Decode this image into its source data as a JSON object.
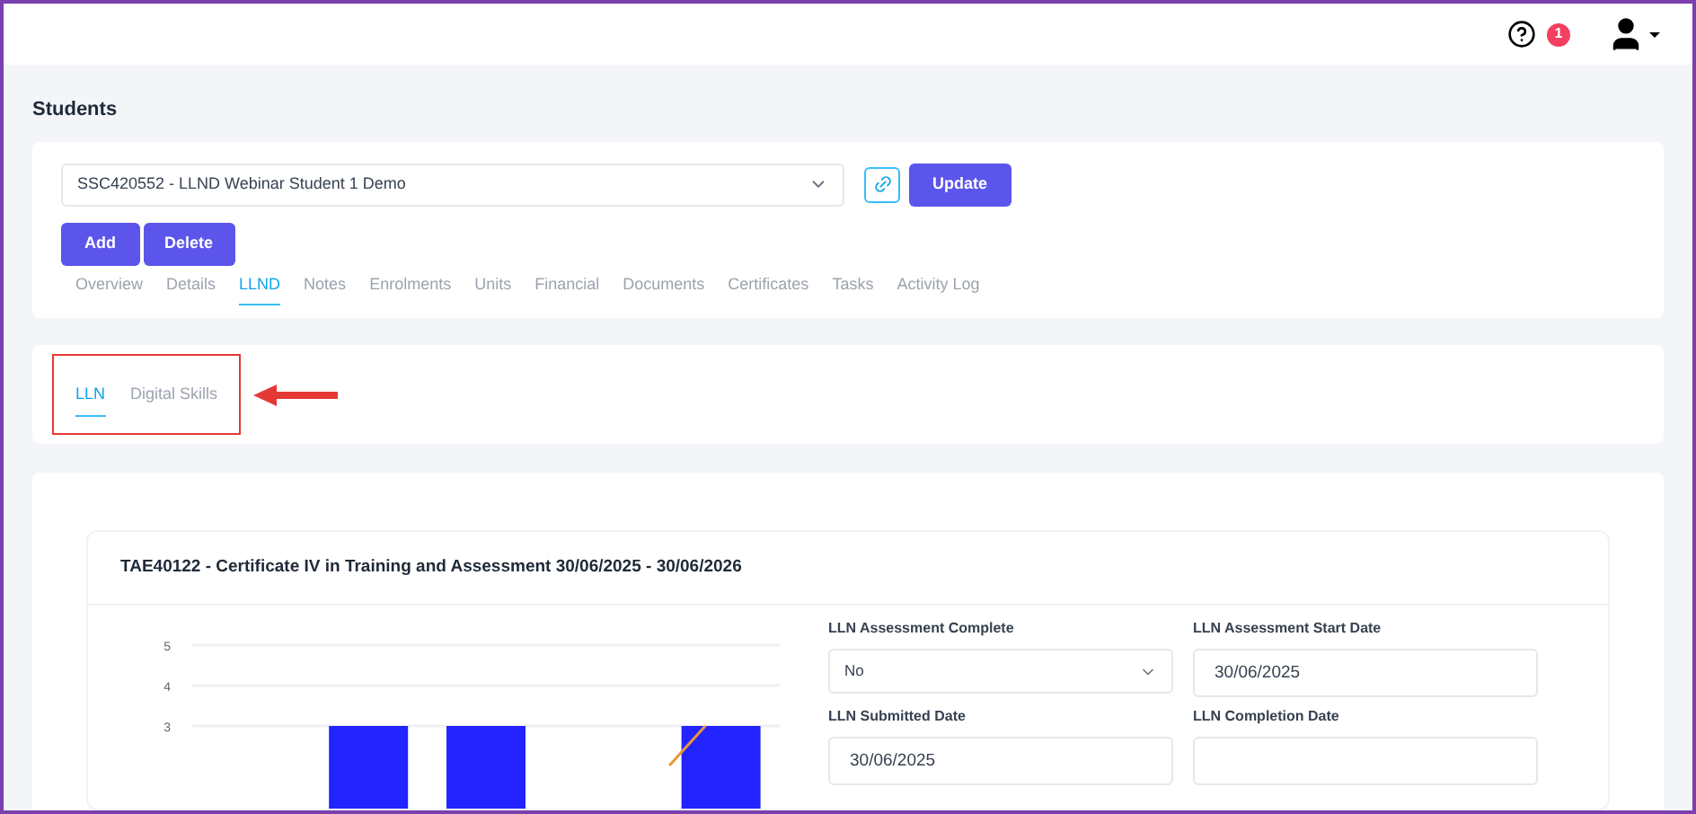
{
  "header": {
    "notification_count": "1"
  },
  "page_title": "Students",
  "student_select": {
    "value": "SSC420552 - LLND Webinar Student 1 Demo"
  },
  "buttons": {
    "update": "Update",
    "add": "Add",
    "delete": "Delete"
  },
  "tabs": [
    {
      "label": "Overview",
      "selected": false
    },
    {
      "label": "Details",
      "selected": false
    },
    {
      "label": "LLND",
      "selected": true
    },
    {
      "label": "Notes",
      "selected": false
    },
    {
      "label": "Enrolments",
      "selected": false
    },
    {
      "label": "Units",
      "selected": false
    },
    {
      "label": "Financial",
      "selected": false
    },
    {
      "label": "Documents",
      "selected": false
    },
    {
      "label": "Certificates",
      "selected": false
    },
    {
      "label": "Tasks",
      "selected": false
    },
    {
      "label": "Activity Log",
      "selected": false
    }
  ],
  "sub_tabs": [
    {
      "label": "LLN",
      "selected": true
    },
    {
      "label": "Digital Skills",
      "selected": false
    }
  ],
  "course": {
    "title": "TAE40122 - Certificate IV in Training and Assessment 30/06/2025 - 30/06/2026",
    "chart_data": {
      "type": "bar",
      "ylim": [
        0,
        5
      ],
      "yticks": [
        3,
        4,
        5
      ],
      "series": [
        {
          "color": "#2323ff",
          "values": [
            null,
            3,
            3,
            null,
            3
          ]
        }
      ]
    },
    "fields": [
      {
        "kind": "select",
        "label": "LLN Assessment Complete",
        "value": "No"
      },
      {
        "kind": "input",
        "label": "LLN Assessment Start Date",
        "value": "30/06/2025"
      },
      {
        "kind": "input",
        "label": "LLN Submitted Date",
        "value": "30/06/2025"
      },
      {
        "kind": "input",
        "label": "LLN Completion Date"
      }
    ]
  }
}
